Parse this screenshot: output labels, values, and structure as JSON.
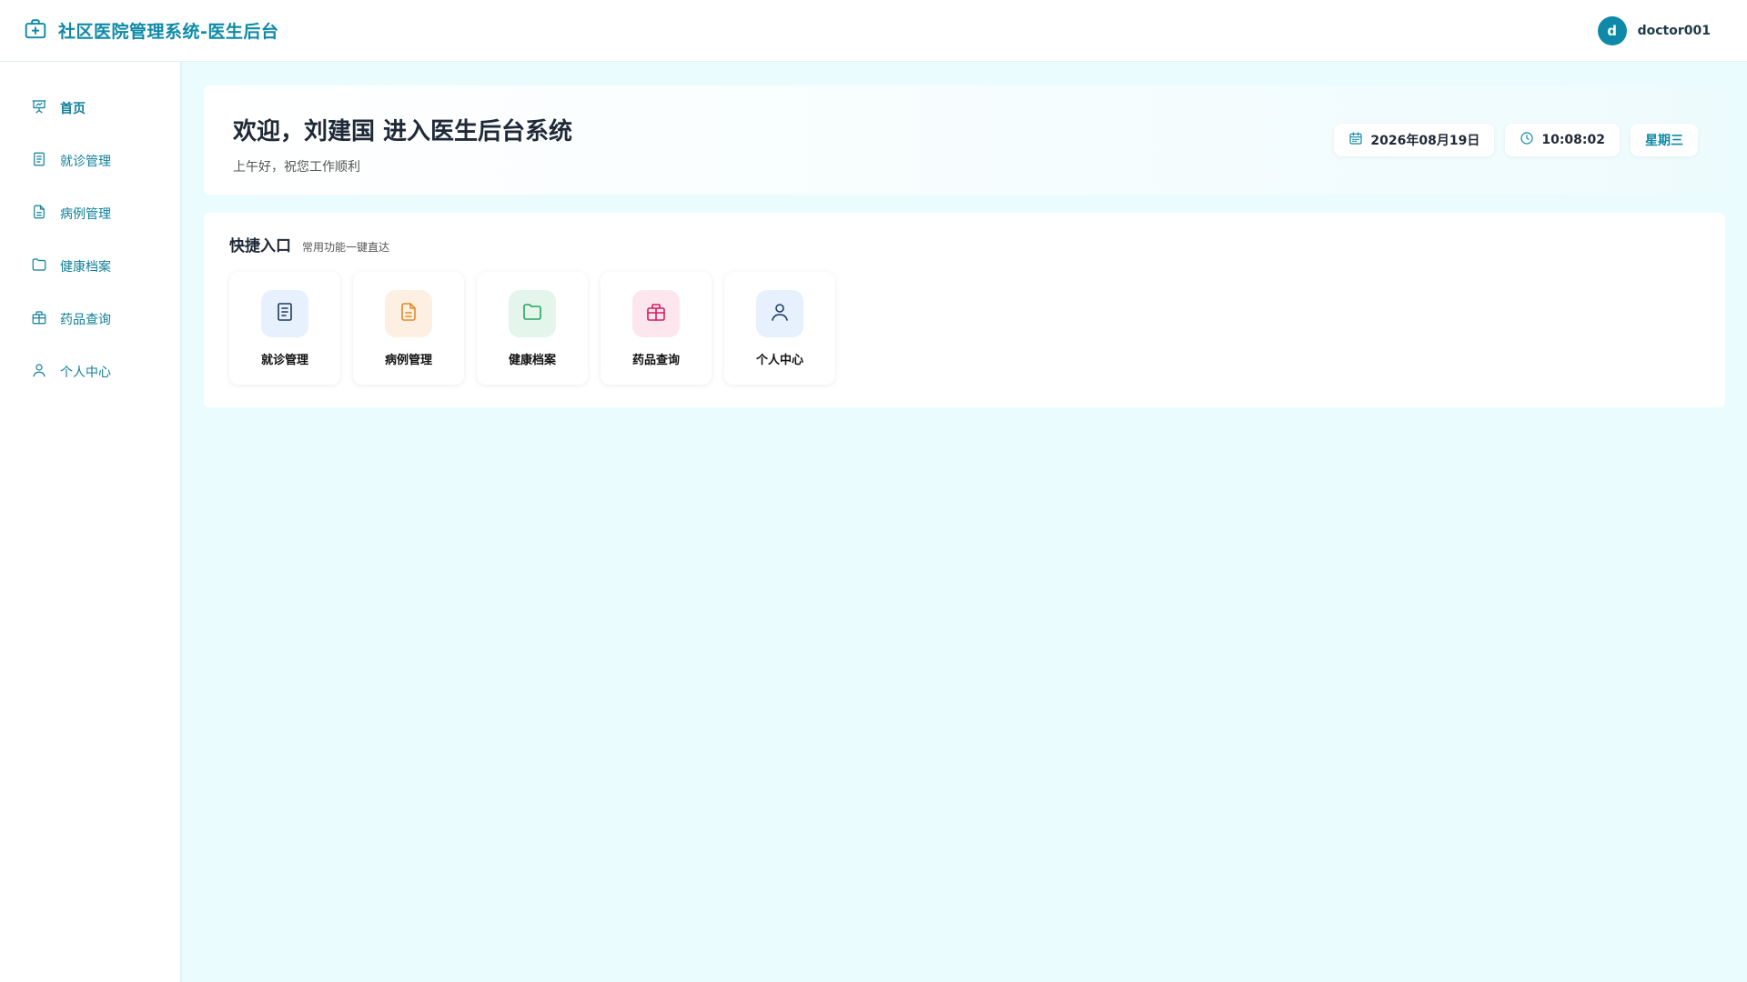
{
  "header": {
    "title": "社区医院管理系统-医生后台",
    "user_initial": "d",
    "username": "doctor001"
  },
  "sidebar": {
    "items": [
      {
        "label": "首页",
        "icon": "presentation-icon",
        "active": true
      },
      {
        "label": "就诊管理",
        "icon": "clipboard-list-icon"
      },
      {
        "label": "病例管理",
        "icon": "file-text-icon"
      },
      {
        "label": "健康档案",
        "icon": "folder-icon"
      },
      {
        "label": "药品查询",
        "icon": "package-icon"
      },
      {
        "label": "个人中心",
        "icon": "user-icon"
      }
    ]
  },
  "welcome": {
    "title": "欢迎，刘建国 进入医生后台系统",
    "subtitle": "上午好，祝您工作顺利",
    "date": "2026年08月19日",
    "time": "10:08:02",
    "weekday": "星期三"
  },
  "quick": {
    "title": "快捷入口",
    "subtitle": "常用功能一键直达",
    "cards": [
      {
        "label": "就诊管理",
        "icon": "clipboard-list-icon",
        "bg": "#e6f1fd",
        "color": "#1e3a5f"
      },
      {
        "label": "病例管理",
        "icon": "file-text-icon",
        "bg": "#fdf0e2",
        "color": "#e08a2c"
      },
      {
        "label": "健康档案",
        "icon": "folder-icon",
        "bg": "#e4f6ec",
        "color": "#2aa25c"
      },
      {
        "label": "药品查询",
        "icon": "package-icon",
        "bg": "#fde6ee",
        "color": "#d81b60"
      },
      {
        "label": "个人中心",
        "icon": "user-icon",
        "bg": "#e6f1fd",
        "color": "#1e3a5f"
      }
    ]
  },
  "colors": {
    "accent": "#0e8aa8",
    "main_bg": "#eafcfd"
  }
}
